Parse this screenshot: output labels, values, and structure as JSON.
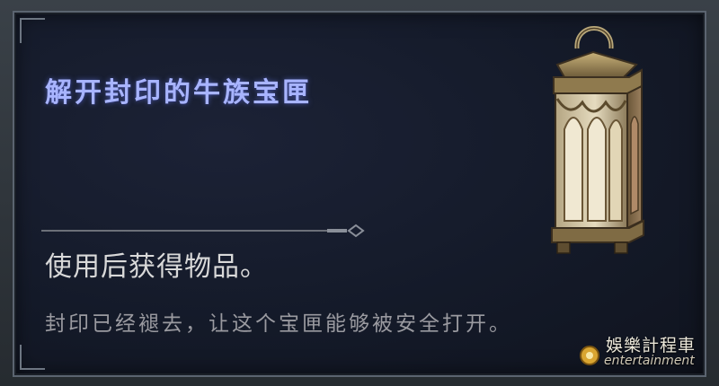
{
  "item": {
    "name": "解开封印的牛族宝匣",
    "effect": "使用后获得物品。",
    "description": "封印已经褪去，让这个宝匣能够被安全打开。",
    "icon": "ornate-lantern-box-icon"
  },
  "watermark": {
    "text": "娛樂計程車",
    "sub": "entertainment"
  },
  "colors": {
    "title": "#a8b4ff",
    "effect_text": "#d9d9d9",
    "description_text": "#9a9aa0",
    "panel_bg": "#141a29",
    "frame": "#5b6470"
  }
}
